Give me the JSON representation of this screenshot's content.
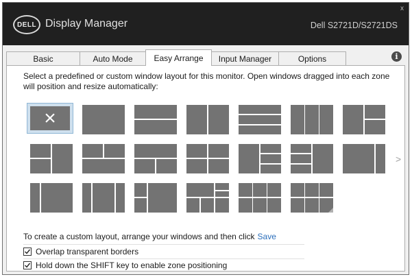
{
  "window": {
    "logo_text": "DELL",
    "app_title": "Display Manager",
    "monitor_model": "Dell S2721D/S2721DS",
    "close_glyph": "x"
  },
  "tabs": [
    {
      "label": "Basic",
      "active": false
    },
    {
      "label": "Auto Mode",
      "active": false
    },
    {
      "label": "Easy Arrange",
      "active": true
    },
    {
      "label": "Input Manager",
      "active": false
    },
    {
      "label": "Options",
      "active": false
    }
  ],
  "info_glyph": "i",
  "easy_arrange": {
    "description": "Select a predefined or custom window layout for this monitor.  Open windows dragged into each zone will position and resize automatically:",
    "selected_layout_glyph": "×",
    "next_page_glyph": ">",
    "custom_prompt": "To create a custom layout, arrange your windows and then click",
    "save_label": "Save",
    "options": [
      {
        "label": "Overlap transparent borders",
        "checked": true
      },
      {
        "label": "Hold down the SHIFT key to enable zone positioning",
        "checked": true
      }
    ]
  },
  "colors": {
    "titlebar": "#202020",
    "zone": "#737373",
    "selected_bg": "#cfe0ee",
    "link": "#2a6ebb"
  }
}
